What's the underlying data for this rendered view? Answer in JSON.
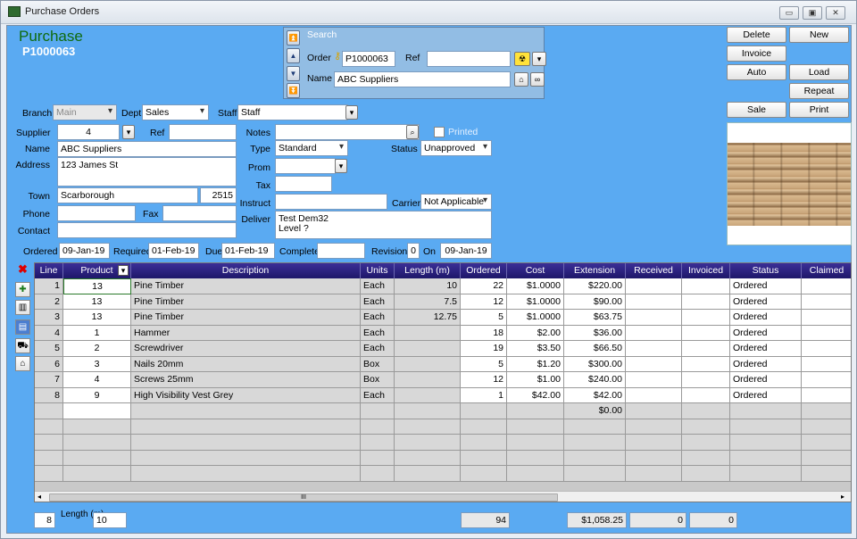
{
  "window": {
    "title": "Purchase Orders",
    "min": "▭",
    "max": "▣",
    "close": "✕"
  },
  "header": {
    "title": "Purchase",
    "number": "P1000063"
  },
  "search": {
    "label": "Search",
    "order_label": "Order",
    "order_value": "P1000063",
    "ref_label": "Ref",
    "ref_value": "",
    "name_label": "Name",
    "name_value": "ABC Suppliers"
  },
  "buttons": {
    "delete": "Delete",
    "new": "New",
    "invoice": "Invoice",
    "auto": "Auto",
    "load": "Load",
    "repeat": "Repeat",
    "sale": "Sale",
    "print": "Print"
  },
  "form": {
    "branch_label": "Branch",
    "branch_value": "Main",
    "dept_label": "Dept",
    "dept_value": "Sales",
    "staff_label": "Staff",
    "staff_value": "Staff",
    "supplier_label": "Supplier",
    "supplier_value": "4",
    "ref_label": "Ref",
    "ref_value": "",
    "name_label": "Name",
    "name_value": "ABC Suppliers",
    "address_label": "Address",
    "address_value": "123 James St",
    "town_label": "Town",
    "town_value": "Scarborough",
    "postcode_value": "2515",
    "phone_label": "Phone",
    "phone_value": "",
    "fax_label": "Fax",
    "fax_value": "",
    "contact_label": "Contact",
    "contact_value": "",
    "notes_label": "Notes",
    "notes_value": "",
    "printed_label": "Printed",
    "type_label": "Type",
    "type_value": "Standard",
    "status_label": "Status",
    "status_value": "Unapproved",
    "prom_label": "Prom",
    "prom_value": "",
    "tax_label": "Tax",
    "tax_value": "",
    "instruct_label": "Instruct",
    "instruct_value": "",
    "carrier_label": "Carrier",
    "carrier_value": "Not Applicable",
    "deliver_label": "Deliver",
    "deliver_line1": "Test Dem32",
    "deliver_line2": "Level ?",
    "ordered_label": "Ordered",
    "ordered_value": "09-Jan-19",
    "required_label": "Required",
    "required_value": "01-Feb-19",
    "due_label": "Due",
    "due_value": "01-Feb-19",
    "complete_label": "Complete",
    "complete_value": "",
    "revision_label": "Revision",
    "revision_value": "0",
    "on_label": "On",
    "on_value": "09-Jan-19"
  },
  "grid": {
    "columns": [
      "Line",
      "Product",
      "Description",
      "Units",
      "Length (m)",
      "Ordered",
      "Cost",
      "Extension",
      "Received",
      "Invoiced",
      "Status",
      "Claimed"
    ],
    "rows": [
      [
        "1",
        "13",
        "Pine Timber",
        "Each",
        "10",
        "22",
        "$1.0000",
        "$220.00",
        "",
        "",
        "Ordered",
        ""
      ],
      [
        "2",
        "13",
        "Pine Timber",
        "Each",
        "7.5",
        "12",
        "$1.0000",
        "$90.00",
        "",
        "",
        "Ordered",
        ""
      ],
      [
        "3",
        "13",
        "Pine Timber",
        "Each",
        "12.75",
        "5",
        "$1.0000",
        "$63.75",
        "",
        "",
        "Ordered",
        ""
      ],
      [
        "4",
        "1",
        "Hammer",
        "Each",
        "",
        "18",
        "$2.00",
        "$36.00",
        "",
        "",
        "Ordered",
        ""
      ],
      [
        "5",
        "2",
        "Screwdriver",
        "Each",
        "",
        "19",
        "$3.50",
        "$66.50",
        "",
        "",
        "Ordered",
        ""
      ],
      [
        "6",
        "3",
        "Nails 20mm",
        "Box",
        "",
        "5",
        "$1.20",
        "$300.00",
        "",
        "",
        "Ordered",
        ""
      ],
      [
        "7",
        "4",
        "Screws 25mm",
        "Box",
        "",
        "12",
        "$1.00",
        "$240.00",
        "",
        "",
        "Ordered",
        ""
      ],
      [
        "8",
        "9",
        "High Visibility Vest Grey",
        "Each",
        "",
        "1",
        "$42.00",
        "$42.00",
        "",
        "",
        "Ordered",
        ""
      ]
    ],
    "blank_extension": "$0.00",
    "scroll_grip": "III"
  },
  "footer": {
    "line_count": "8",
    "length_label": "Length (m)",
    "length_value": "10",
    "ordered_total": "94",
    "extension_total": "$1,058.25",
    "received_total": "0",
    "invoiced_total": "0"
  }
}
